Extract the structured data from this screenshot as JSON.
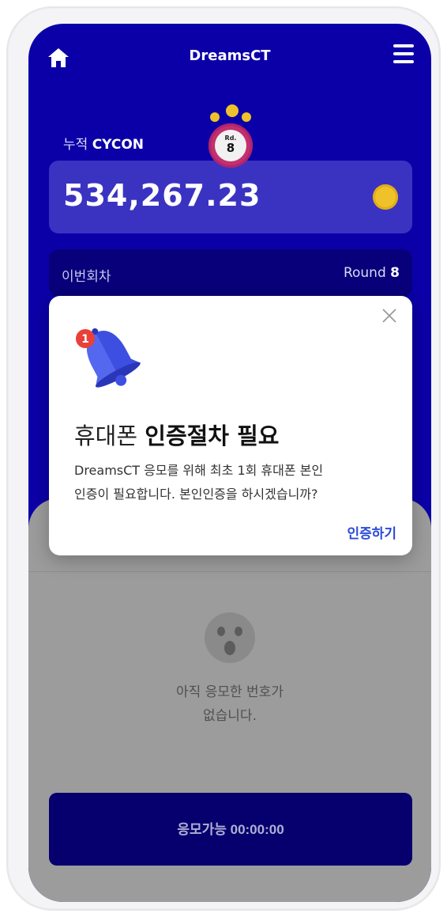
{
  "header": {
    "title": "DreamsCT",
    "home_icon": "home-icon",
    "menu_icon": "menu-icon"
  },
  "cumulative": {
    "label_prefix": "누적",
    "label_token": "CYCON",
    "balance": "534,267.23"
  },
  "round_badge": {
    "small": "Rd.",
    "number": "8"
  },
  "current_round": {
    "label": "이번회차",
    "round_word": "Round",
    "round_number": "8"
  },
  "empty_state": {
    "line1": "아직 응모한 번호가",
    "line2": "없습니다."
  },
  "cta": {
    "label": "응모가능 00:00:00"
  },
  "modal": {
    "title_light": "휴대폰",
    "title_bold": "인증절차 필요",
    "body_line1": "DreamsCT 응모를 위해 최초 1회 휴대폰 본인",
    "body_line2": "인증이 필요합니다. 본인인증을 하시겠습니까?",
    "action_label": "인증하기",
    "badge_count": "1"
  },
  "colors": {
    "brand_blue": "#0b00a8",
    "link_blue": "#2b4bd6",
    "coin_gold": "#f0c22a",
    "badge_red": "#e8403a"
  }
}
